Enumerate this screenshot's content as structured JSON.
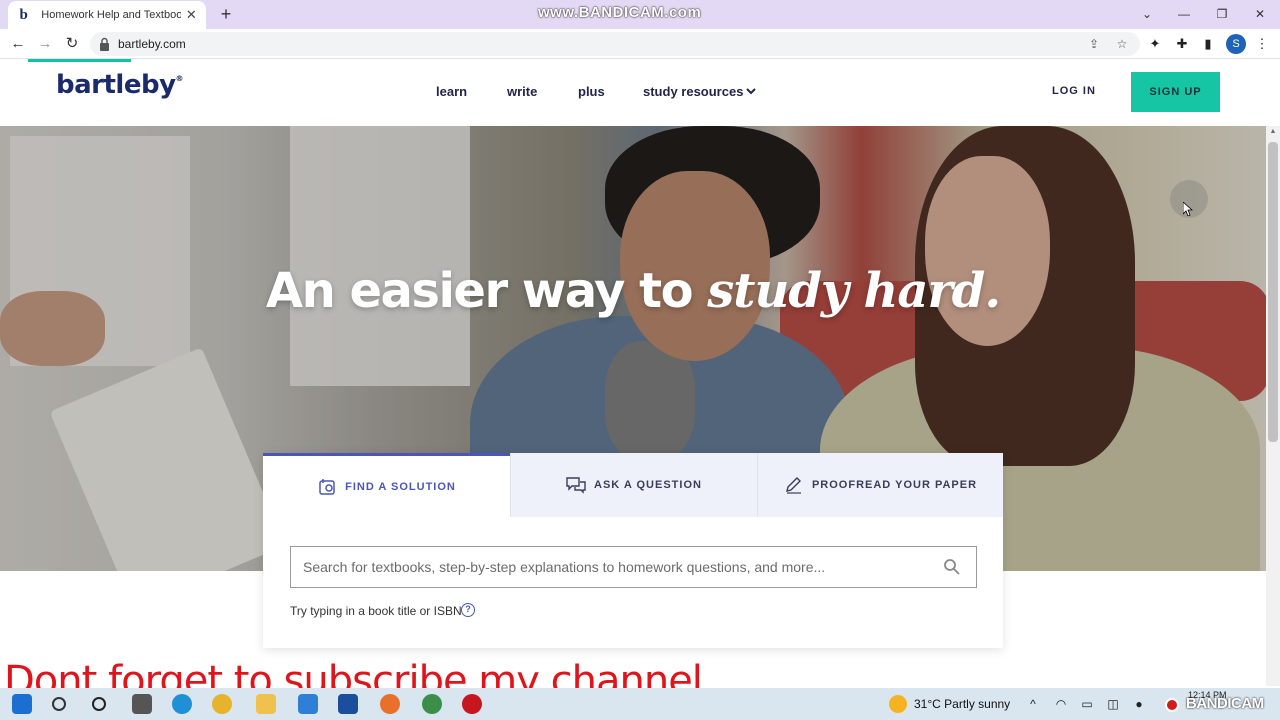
{
  "browser": {
    "tab_title": "Homework Help and Textbook So",
    "tab_favicon": "b",
    "new_tab": "+",
    "url": "bartleby.com",
    "watermark": "www.BANDICAM.com",
    "profile_initial": "S",
    "icons": [
      "back-icon",
      "forward-icon",
      "reload-icon",
      "lock-icon",
      "share-icon",
      "star-icon",
      "extension-icon",
      "puzzle-icon",
      "sidepanel-icon"
    ]
  },
  "site": {
    "logo": "bartleby",
    "logo_mark": "®",
    "nav": [
      "learn",
      "write",
      "plus",
      "study resources"
    ],
    "login": "LOG IN",
    "signup": "SIGN UP"
  },
  "hero": {
    "headline_plain": "An easier way to ",
    "headline_em": "study hard."
  },
  "search_card": {
    "tabs": [
      "FIND A SOLUTION",
      "ASK A QUESTION",
      "PROOFREAD YOUR PAPER"
    ],
    "active_tab": "FIND A SOLUTION",
    "placeholder": "Search for textbooks, step-by-step explanations to homework questions, and more...",
    "hint": "Try typing in a book title or ISBN",
    "help": "?"
  },
  "overlay": {
    "caption": "Dont forget to subscribe my channel"
  },
  "taskbar": {
    "weather": "31°C  Partly sunny",
    "clock": "12:14 PM",
    "recorder": "BANDICAM"
  },
  "colors": {
    "brand_navy": "#1b2a6b",
    "accent_teal": "#15c5a4",
    "tab_active": "#4b56b8",
    "tabstrip": "#e4d9f5"
  }
}
